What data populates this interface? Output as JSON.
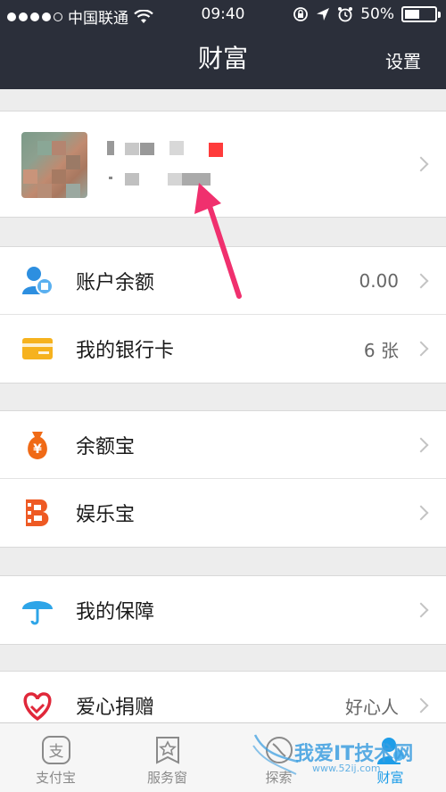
{
  "status_bar": {
    "carrier": "中国联通",
    "time": "09:40",
    "battery": "50%",
    "battery_level": 0.5
  },
  "nav": {
    "title": "财富",
    "settings": "设置"
  },
  "profile": {},
  "section1": [
    {
      "label": "账户余额",
      "value": "0.00",
      "icon": "account-balance-icon"
    },
    {
      "label": "我的银行卡",
      "value": "6 张",
      "icon": "bank-card-icon"
    }
  ],
  "section2": [
    {
      "label": "余额宝",
      "value": "",
      "icon": "yuebao-icon"
    },
    {
      "label": "娱乐宝",
      "value": "",
      "icon": "yulebao-icon"
    }
  ],
  "section3": [
    {
      "label": "我的保障",
      "value": "",
      "icon": "umbrella-icon"
    }
  ],
  "section4": [
    {
      "label": "爱心捐赠",
      "value": "好心人",
      "icon": "heart-icon"
    }
  ],
  "tabs": [
    {
      "label": "支付宝",
      "icon": "alipay-icon"
    },
    {
      "label": "服务窗",
      "icon": "service-window-icon"
    },
    {
      "label": "探索",
      "icon": "explore-icon"
    },
    {
      "label": "财富",
      "icon": "wealth-icon"
    }
  ],
  "watermark": {
    "text": "我爱IT技术网",
    "url": "www.52ij.com"
  },
  "colors": {
    "header_bg": "#2b2f3a",
    "accent_blue": "#1e9de8",
    "annotation_arrow": "#f0306e"
  }
}
